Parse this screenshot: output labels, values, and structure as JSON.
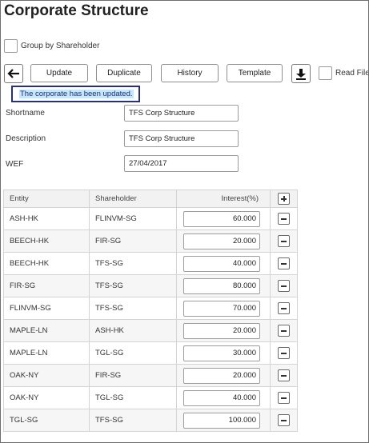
{
  "page": {
    "title": "Corporate Structure"
  },
  "options": {
    "group_by_shareholder": "Group by Shareholder",
    "read_file": "Read File"
  },
  "toolbar": {
    "back_icon": "left-arrow-icon",
    "update": "Update",
    "duplicate": "Duplicate",
    "history": "History",
    "template": "Template",
    "download_icon": "download-icon"
  },
  "notice": "The corporate has been updated.",
  "form": {
    "shortname_label": "Shortname",
    "shortname_value": "TFS Corp Structure",
    "description_label": "Description",
    "description_value": "TFS Corp Structure",
    "wef_label": "WEF",
    "wef_value": "27/04/2017"
  },
  "table": {
    "headers": {
      "entity": "Entity",
      "shareholder": "Shareholder",
      "interest": "Interest(%)"
    },
    "add_icon": "plus-icon",
    "remove_icon": "minus-icon",
    "rows": [
      {
        "entity": "ASH-HK",
        "shareholder": "FLINVM-SG",
        "interest": "60.000"
      },
      {
        "entity": "BEECH-HK",
        "shareholder": "FIR-SG",
        "interest": "20.000"
      },
      {
        "entity": "BEECH-HK",
        "shareholder": "TFS-SG",
        "interest": "40.000"
      },
      {
        "entity": "FIR-SG",
        "shareholder": "TFS-SG",
        "interest": "80.000"
      },
      {
        "entity": "FLINVM-SG",
        "shareholder": "TFS-SG",
        "interest": "70.000"
      },
      {
        "entity": "MAPLE-LN",
        "shareholder": "ASH-HK",
        "interest": "20.000"
      },
      {
        "entity": "MAPLE-LN",
        "shareholder": "TGL-SG",
        "interest": "30.000"
      },
      {
        "entity": "OAK-NY",
        "shareholder": "FIR-SG",
        "interest": "20.000"
      },
      {
        "entity": "OAK-NY",
        "shareholder": "TGL-SG",
        "interest": "40.000"
      },
      {
        "entity": "TGL-SG",
        "shareholder": "TFS-SG",
        "interest": "100.000"
      }
    ]
  }
}
